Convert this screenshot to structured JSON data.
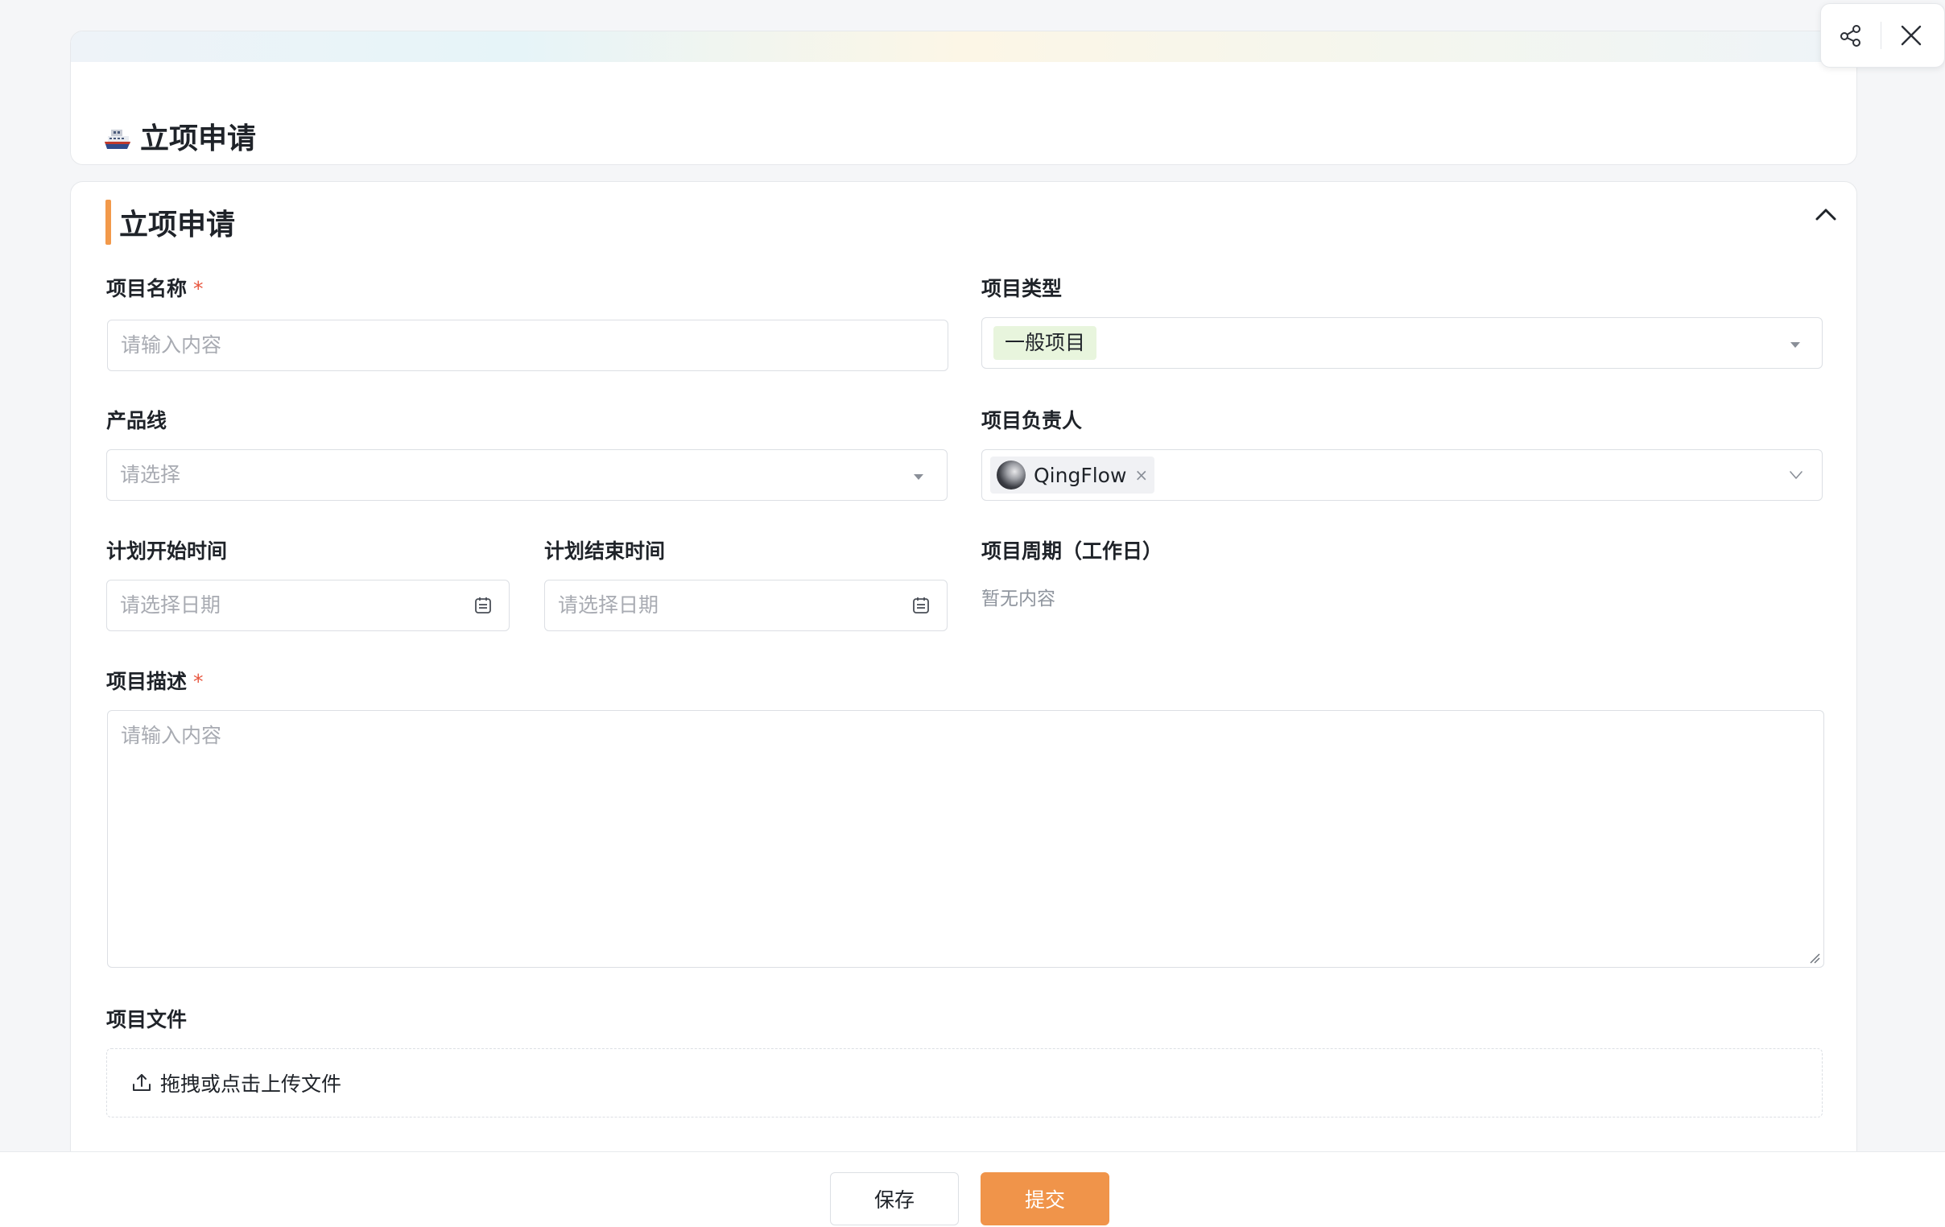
{
  "header": {
    "title": "立项申请"
  },
  "float_actions": {
    "share_icon": "share-icon",
    "close_icon": "close-icon"
  },
  "section": {
    "title": "立项申请",
    "accent_color": "#f2994a"
  },
  "fields": {
    "project_name": {
      "label": "项目名称",
      "required_mark": "*",
      "placeholder": "请输入内容",
      "value": ""
    },
    "project_type": {
      "label": "项目类型",
      "value": "一般项目"
    },
    "product_line": {
      "label": "产品线",
      "placeholder": "请选择"
    },
    "project_owner": {
      "label": "项目负责人",
      "value": "QingFlow",
      "remove": "×"
    },
    "plan_start": {
      "label": "计划开始时间",
      "placeholder": "请选择日期"
    },
    "plan_end": {
      "label": "计划结束时间",
      "placeholder": "请选择日期"
    },
    "project_cycle": {
      "label": "项目周期（工作日）",
      "value": "暂无内容"
    },
    "project_desc": {
      "label": "项目描述",
      "required_mark": "*",
      "placeholder": "请输入内容"
    },
    "project_files": {
      "label": "项目文件",
      "upload_text": "拖拽或点击上传文件"
    }
  },
  "footer": {
    "save_label": "保存",
    "submit_label": "提交",
    "submit_color": "#f0944a"
  }
}
